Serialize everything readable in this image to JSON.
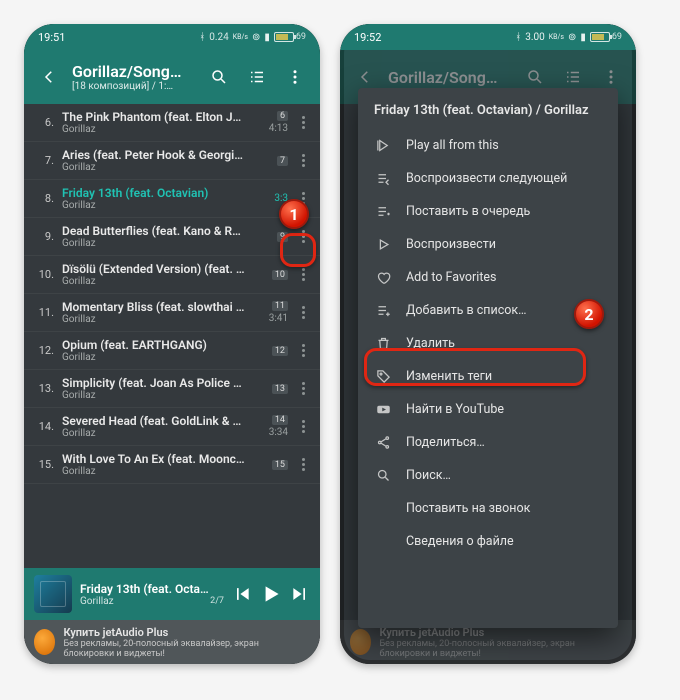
{
  "colors": {
    "teal": "#1F7A70",
    "accent": "#20C2B3",
    "red": "#E02613",
    "bg": "#34393d"
  },
  "phone1": {
    "status": {
      "time": "19:51",
      "net": "0.24",
      "netUnit": "KB/s",
      "battery": 69,
      "batteryLabel": "69"
    },
    "appbar": {
      "title": "Gorillaz/Song…",
      "subtitle": "[18 композиций] / 1:…"
    },
    "tracks": [
      {
        "n": "6.",
        "title": "The Pink Phantom (feat. Elton Joh…",
        "artist": "Gorillaz",
        "badge": "6",
        "dur": "4:13"
      },
      {
        "n": "7.",
        "title": "Aries (feat. Peter Hook & Georgi…",
        "artist": "Gorillaz",
        "badge": "7",
        "dur": ""
      },
      {
        "n": "8.",
        "title": "Friday 13th (feat. Octavian)",
        "artist": "Gorillaz",
        "badge": "",
        "dur": "3:3",
        "active": true
      },
      {
        "n": "9.",
        "title": "Dead Butterflies (feat. Kano & Rox…",
        "artist": "Gorillaz",
        "badge": "9",
        "dur": ""
      },
      {
        "n": "10.",
        "title": "Dïsölü (Extended Version) (feat. …",
        "artist": "Gorillaz",
        "badge": "10",
        "dur": ""
      },
      {
        "n": "11.",
        "title": "Momentary Bliss (feat. slowthai &…",
        "artist": "Gorillaz",
        "badge": "11",
        "dur": "3:41"
      },
      {
        "n": "12.",
        "title": "Opium (feat. EARTHGANG)",
        "artist": "Gorillaz",
        "badge": "12",
        "dur": ""
      },
      {
        "n": "13.",
        "title": "Simplicity (feat. Joan As Police W…",
        "artist": "Gorillaz",
        "badge": "13",
        "dur": ""
      },
      {
        "n": "14.",
        "title": "Severed Head (feat. GoldLink & U…",
        "artist": "Gorillaz",
        "badge": "14",
        "dur": "3:34"
      },
      {
        "n": "15.",
        "title": "With Love To An Ex (feat. Moonch…",
        "artist": "Gorillaz",
        "badge": "15",
        "dur": ""
      }
    ],
    "nowPlaying": {
      "title": "Friday 13th (feat. Octa…",
      "artist": "Gorillaz",
      "pos": "2/7"
    },
    "ad": {
      "headline": "Купить jetAudio Plus",
      "body": "Без рекламы, 20-полосный эквалайзер, экран блокировки и виджеты!"
    },
    "callout": "1"
  },
  "phone2": {
    "status": {
      "time": "19:52",
      "net": "3.00",
      "netUnit": "KB/s",
      "battery": 69,
      "batteryLabel": "69"
    },
    "appbar": {
      "title": "Gorillaz/Song…",
      "subtitle": ""
    },
    "menu": {
      "header": "Friday 13th (feat. Octavian) / Gorillaz",
      "items": [
        {
          "icon": "play-all",
          "label": "Play all from this"
        },
        {
          "icon": "play-next",
          "label": "Воспроизвести следующей"
        },
        {
          "icon": "queue",
          "label": "Поставить в очередь"
        },
        {
          "icon": "play",
          "label": "Воспроизвести"
        },
        {
          "icon": "heart",
          "label": "Add to Favorites"
        },
        {
          "icon": "playlist-add",
          "label": "Добавить в список…",
          "highlight": true
        },
        {
          "icon": "trash",
          "label": "Удалить"
        },
        {
          "icon": "tag",
          "label": "Изменить теги"
        },
        {
          "icon": "youtube",
          "label": "Найти в YouTube"
        },
        {
          "icon": "share",
          "label": "Поделиться…"
        },
        {
          "icon": "search",
          "label": "Поиск…"
        },
        {
          "icon": "",
          "label": "Поставить на звонок"
        },
        {
          "icon": "",
          "label": "Сведения о файле"
        }
      ]
    },
    "callout": "2"
  }
}
